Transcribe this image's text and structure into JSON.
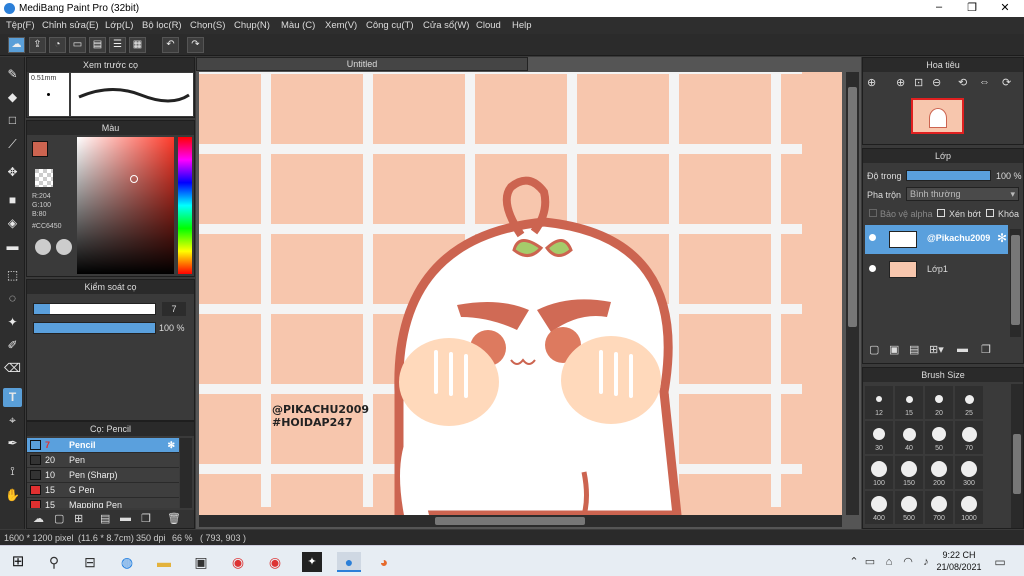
{
  "window": {
    "title": "MediBang Paint Pro (32bit)",
    "min": "–",
    "max": "❐",
    "close": "✕"
  },
  "menu": [
    "Tệp(F)",
    "Chỉnh sửa(E)",
    "Lớp(L)",
    "Bộ lọc(R)",
    "Chọn(S)",
    "Chụp(N)",
    "Màu (C)",
    "Xem(V)",
    "Công cụ(T)",
    "Cửa sổ(W)",
    "Cloud",
    "Help"
  ],
  "brush_preview": {
    "title": "Xem trước cọ",
    "size": "0.51mm"
  },
  "color_panel": {
    "title": "Màu",
    "r": "R:204",
    "g": "G:100",
    "b": "B:80",
    "hex": "#CC6450",
    "primary": "#cc6450"
  },
  "brush_control": {
    "title": "Kiểm soát cọ",
    "size": "7",
    "opacity": "100 %",
    "opacity_fraction": 1.0
  },
  "brush_list": {
    "title": "Cọ: Pencil",
    "items": [
      {
        "size": "7",
        "name": "Pencil",
        "color": "#5a9fd8",
        "selected": true
      },
      {
        "size": "20",
        "name": "Pen",
        "color": "#333333",
        "selected": false
      },
      {
        "size": "10",
        "name": "Pen (Sharp)",
        "color": "#333333",
        "selected": false
      },
      {
        "size": "15",
        "name": "G Pen",
        "color": "#e03030",
        "selected": false
      },
      {
        "size": "15",
        "name": "Mapping Pen",
        "color": "#e03030",
        "selected": false
      }
    ]
  },
  "document": {
    "tab": "Untitled",
    "watermark1": "@PIKACHU2009",
    "watermark2": "#HOIDAP247"
  },
  "navigator": {
    "title": "Hoa tiêu"
  },
  "layers": {
    "title": "Lớp",
    "opacity_label": "Độ trong",
    "opacity_value": "100 %",
    "opacity_fraction": 1.0,
    "blend_label": "Pha trộn",
    "blend_value": "Bình thường",
    "protect_alpha": "Bảo vệ alpha",
    "clip": "Xén bớt",
    "lock": "Khóa",
    "items": [
      {
        "name": "@Pikachu2009",
        "selected": true
      },
      {
        "name": "Lớp1",
        "selected": false
      }
    ]
  },
  "brush_size": {
    "title": "Brush Size",
    "sizes": [
      "12",
      "15",
      "20",
      "25",
      "30",
      "40",
      "50",
      "70",
      "100",
      "150",
      "200",
      "300",
      "400",
      "500",
      "700",
      "1000"
    ]
  },
  "status": {
    "dims": "1600 * 1200 pixel",
    "phys": "(11.6 * 8.7cm)",
    "dpi": "350 dpi",
    "zoom": "66 %",
    "coords": "( 793, 903 )"
  },
  "taskbar": {
    "time": "9:22 CH",
    "date": "21/08/2021"
  }
}
